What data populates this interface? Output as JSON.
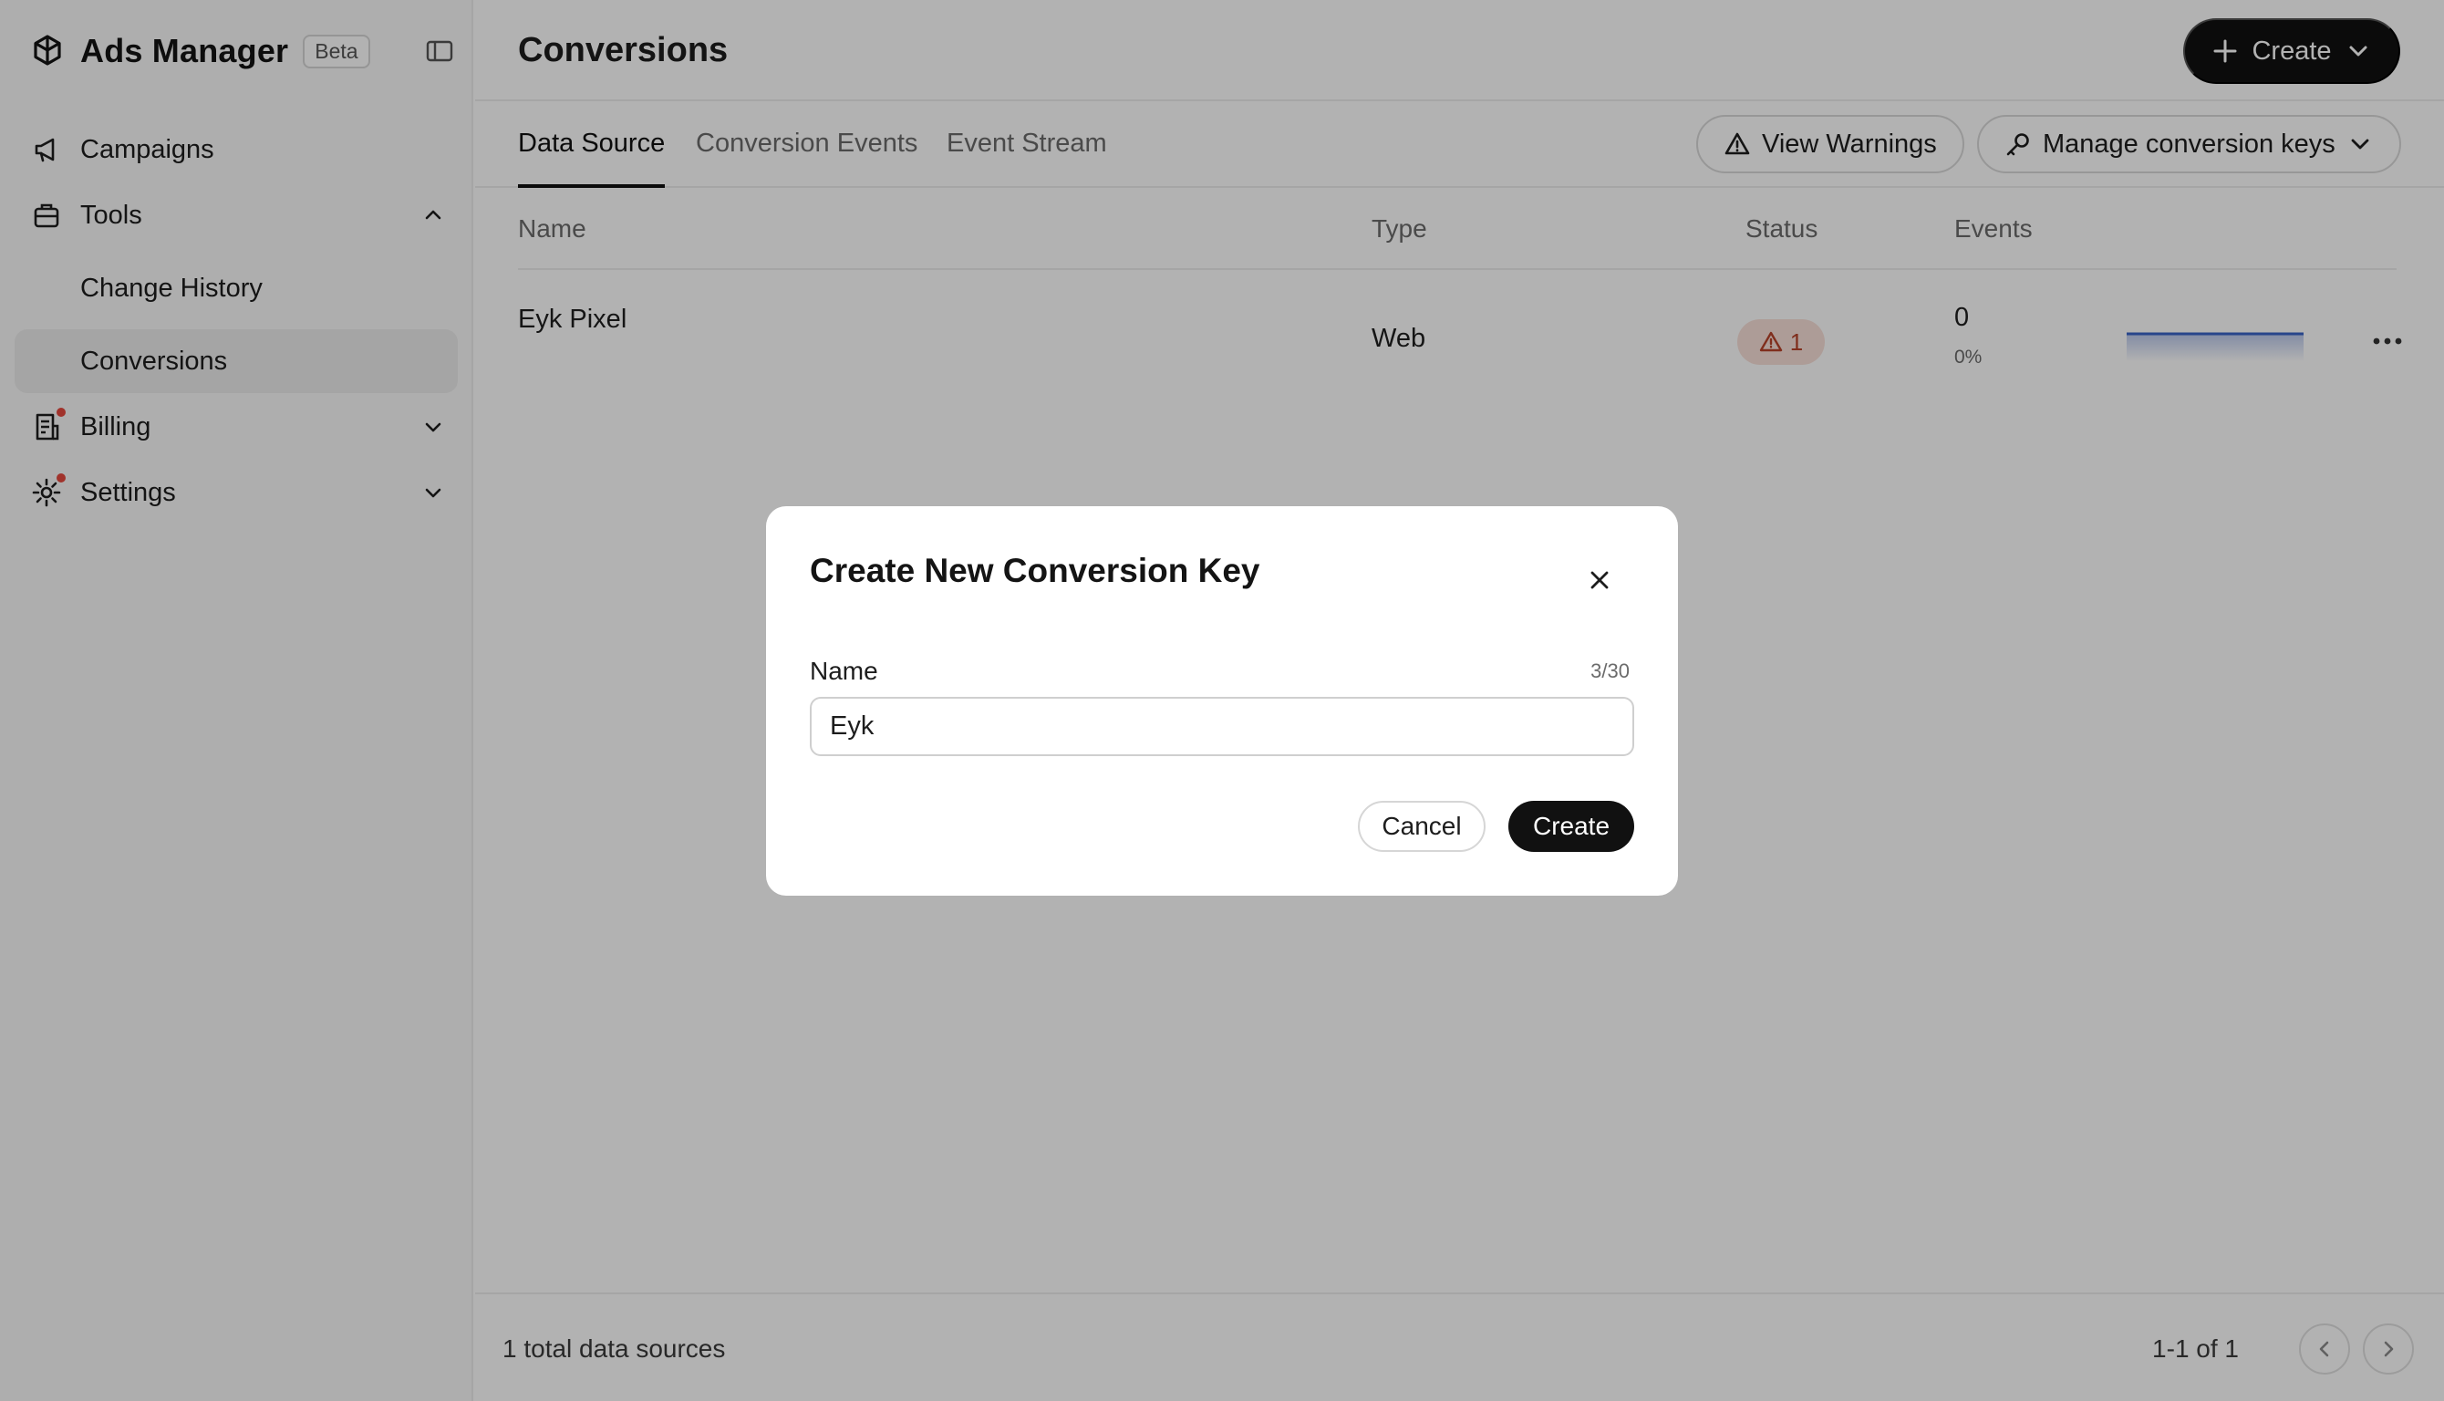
{
  "app": {
    "name": "Ads Manager",
    "badge": "Beta"
  },
  "sidebar": {
    "items": [
      {
        "label": "Campaigns",
        "icon": "megaphone-icon"
      },
      {
        "label": "Tools",
        "icon": "toolbox-icon",
        "expanded": true
      },
      {
        "label": "Change History"
      },
      {
        "label": "Conversions",
        "active": true
      },
      {
        "label": "Billing",
        "icon": "receipt-icon",
        "notification": true
      },
      {
        "label": "Settings",
        "icon": "gear-icon",
        "notification": true
      }
    ]
  },
  "header": {
    "title": "Conversions",
    "create_label": "Create"
  },
  "tabs": [
    {
      "label": "Data Source",
      "active": true
    },
    {
      "label": "Conversion Events"
    },
    {
      "label": "Event Stream"
    }
  ],
  "actions": {
    "view_warnings": "View Warnings",
    "manage_keys": "Manage conversion keys"
  },
  "table": {
    "columns": [
      "Name",
      "Type",
      "Status",
      "Events"
    ],
    "rows": [
      {
        "name": "Eyk Pixel",
        "type": "Web",
        "status_count": "1",
        "events": "0",
        "events_pct": "0%"
      }
    ]
  },
  "footer": {
    "total": "1 total data sources",
    "range": "1-1 of 1"
  },
  "modal": {
    "title": "Create New Conversion Key",
    "field_label": "Name",
    "char_count": "3/30",
    "input_value": "Eyk",
    "cancel_label": "Cancel",
    "create_label": "Create"
  },
  "colors": {
    "accent": "#111111",
    "warning_bg": "#f8e0d8",
    "warning_text": "#b8432a",
    "notification": "#e5483e",
    "sparkline": "#3a63c8"
  }
}
